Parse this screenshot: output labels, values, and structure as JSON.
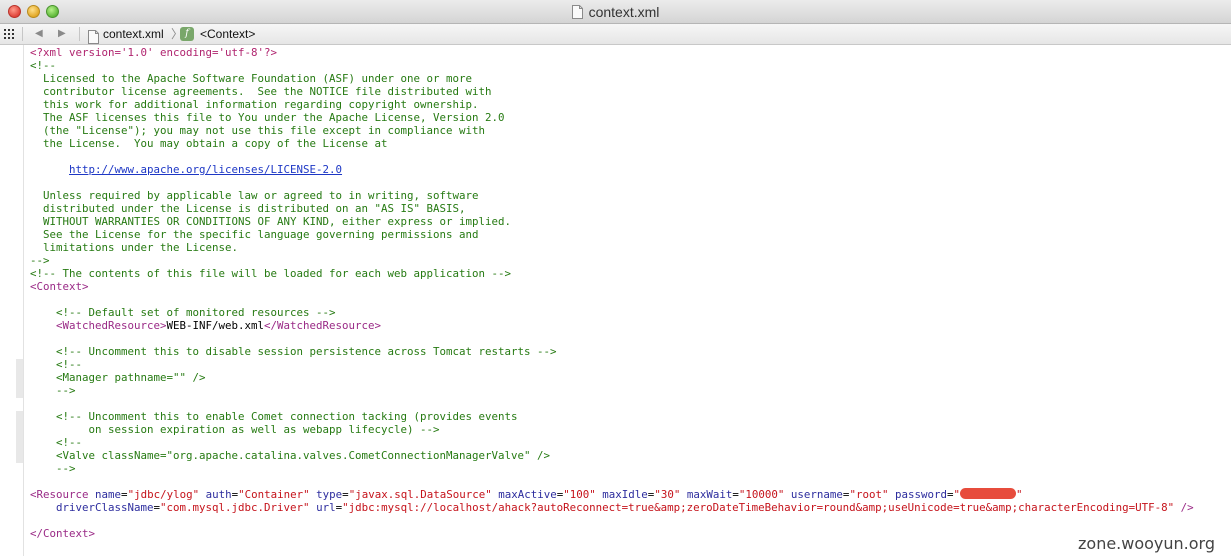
{
  "window": {
    "title": "context.xml"
  },
  "nav": {
    "file_name": "context.xml",
    "separator": "〉",
    "element_name": "<Context>",
    "f_icon_label": "f"
  },
  "code_lines": [
    [
      {
        "t": "pi",
        "v": "<?xml version='1.0' encoding='utf-8'?>"
      }
    ],
    [
      {
        "t": "comment",
        "v": "<!--"
      }
    ],
    [
      {
        "t": "comment",
        "v": "  Licensed to the Apache Software Foundation (ASF) under one or more"
      }
    ],
    [
      {
        "t": "comment",
        "v": "  contributor license agreements.  See the NOTICE file distributed with"
      }
    ],
    [
      {
        "t": "comment",
        "v": "  this work for additional information regarding copyright ownership."
      }
    ],
    [
      {
        "t": "comment",
        "v": "  The ASF licenses this file to You under the Apache License, Version 2.0"
      }
    ],
    [
      {
        "t": "comment",
        "v": "  (the \"License\"); you may not use this file except in compliance with"
      }
    ],
    [
      {
        "t": "comment",
        "v": "  the License.  You may obtain a copy of the License at"
      }
    ],
    [],
    [
      {
        "t": "comment",
        "v": "      "
      },
      {
        "t": "url",
        "v": "http://www.apache.org/licenses/LICENSE-2.0"
      }
    ],
    [],
    [
      {
        "t": "comment",
        "v": "  Unless required by applicable law or agreed to in writing, software"
      }
    ],
    [
      {
        "t": "comment",
        "v": "  distributed under the License is distributed on an \"AS IS\" BASIS,"
      }
    ],
    [
      {
        "t": "comment",
        "v": "  WITHOUT WARRANTIES OR CONDITIONS OF ANY KIND, either express or implied."
      }
    ],
    [
      {
        "t": "comment",
        "v": "  See the License for the specific language governing permissions and"
      }
    ],
    [
      {
        "t": "comment",
        "v": "  limitations under the License."
      }
    ],
    [
      {
        "t": "comment",
        "v": "-->"
      }
    ],
    [
      {
        "t": "comment",
        "v": "<!-- The contents of this file will be loaded for each web application -->"
      }
    ],
    [
      {
        "t": "tag",
        "v": "<Context>"
      }
    ],
    [],
    [
      {
        "t": "comment",
        "v": "    <!-- Default set of monitored resources -->"
      }
    ],
    [
      {
        "t": "txt",
        "v": "    "
      },
      {
        "t": "tag",
        "v": "<WatchedResource>"
      },
      {
        "t": "txt",
        "v": "WEB-INF/web.xml"
      },
      {
        "t": "tag",
        "v": "</WatchedResource>"
      }
    ],
    [],
    [
      {
        "t": "comment",
        "v": "    <!-- Uncomment this to disable session persistence across Tomcat restarts -->"
      }
    ],
    [
      {
        "t": "comment",
        "v": "    <!--"
      }
    ],
    [
      {
        "t": "comment",
        "v": "    <Manager pathname=\"\" />"
      }
    ],
    [
      {
        "t": "comment",
        "v": "    -->"
      }
    ],
    [],
    [
      {
        "t": "comment",
        "v": "    <!-- Uncomment this to enable Comet connection tacking (provides events"
      }
    ],
    [
      {
        "t": "comment",
        "v": "         on session expiration as well as webapp lifecycle) -->"
      }
    ],
    [
      {
        "t": "comment",
        "v": "    <!--"
      }
    ],
    [
      {
        "t": "comment",
        "v": "    <Valve className=\"org.apache.catalina.valves.CometConnectionManagerValve\" />"
      }
    ],
    [
      {
        "t": "comment",
        "v": "    -->"
      }
    ],
    [],
    [
      {
        "t": "tag",
        "v": "<Resource"
      },
      {
        "t": "txt",
        "v": " "
      },
      {
        "t": "attr",
        "v": "name"
      },
      {
        "t": "txt",
        "v": "="
      },
      {
        "t": "str",
        "v": "\"jdbc/ylog\""
      },
      {
        "t": "txt",
        "v": " "
      },
      {
        "t": "attr",
        "v": "auth"
      },
      {
        "t": "txt",
        "v": "="
      },
      {
        "t": "str",
        "v": "\"Container\""
      },
      {
        "t": "txt",
        "v": " "
      },
      {
        "t": "attr",
        "v": "type"
      },
      {
        "t": "txt",
        "v": "="
      },
      {
        "t": "str",
        "v": "\"javax.sql.DataSource\""
      },
      {
        "t": "txt",
        "v": " "
      },
      {
        "t": "attr",
        "v": "maxActive"
      },
      {
        "t": "txt",
        "v": "="
      },
      {
        "t": "str",
        "v": "\"100\""
      },
      {
        "t": "txt",
        "v": " "
      },
      {
        "t": "attr",
        "v": "maxIdle"
      },
      {
        "t": "txt",
        "v": "="
      },
      {
        "t": "str",
        "v": "\"30\""
      },
      {
        "t": "txt",
        "v": " "
      },
      {
        "t": "attr",
        "v": "maxWait"
      },
      {
        "t": "txt",
        "v": "="
      },
      {
        "t": "str",
        "v": "\"10000\""
      },
      {
        "t": "txt",
        "v": " "
      },
      {
        "t": "attr",
        "v": "username"
      },
      {
        "t": "txt",
        "v": "="
      },
      {
        "t": "str",
        "v": "\"root\""
      },
      {
        "t": "txt",
        "v": " "
      },
      {
        "t": "attr",
        "v": "password"
      },
      {
        "t": "txt",
        "v": "="
      },
      {
        "t": "str",
        "v": "\""
      },
      {
        "t": "redact",
        "v": ""
      },
      {
        "t": "str",
        "v": "\""
      }
    ],
    [
      {
        "t": "txt",
        "v": "    "
      },
      {
        "t": "attr",
        "v": "driverClassName"
      },
      {
        "t": "txt",
        "v": "="
      },
      {
        "t": "str",
        "v": "\"com.mysql.jdbc.Driver\""
      },
      {
        "t": "txt",
        "v": " "
      },
      {
        "t": "attr",
        "v": "url"
      },
      {
        "t": "txt",
        "v": "="
      },
      {
        "t": "str",
        "v": "\"jdbc:mysql://localhost/ahack?autoReconnect=true&amp;zeroDateTimeBehavior=round&amp;useUnicode=true&amp;characterEncoding=UTF-8\""
      },
      {
        "t": "txt",
        "v": " "
      },
      {
        "t": "tag",
        "v": "/>"
      }
    ],
    [],
    [
      {
        "t": "tag",
        "v": "</Context>"
      }
    ]
  ],
  "watermark": "zone.wooyun.org",
  "colors": {
    "comment": "#267a12",
    "tag": "#9a2a86",
    "attribute": "#2d2d9e",
    "string": "#c5131b",
    "url": "#1d37c5",
    "redaction": "#e74c3c"
  }
}
